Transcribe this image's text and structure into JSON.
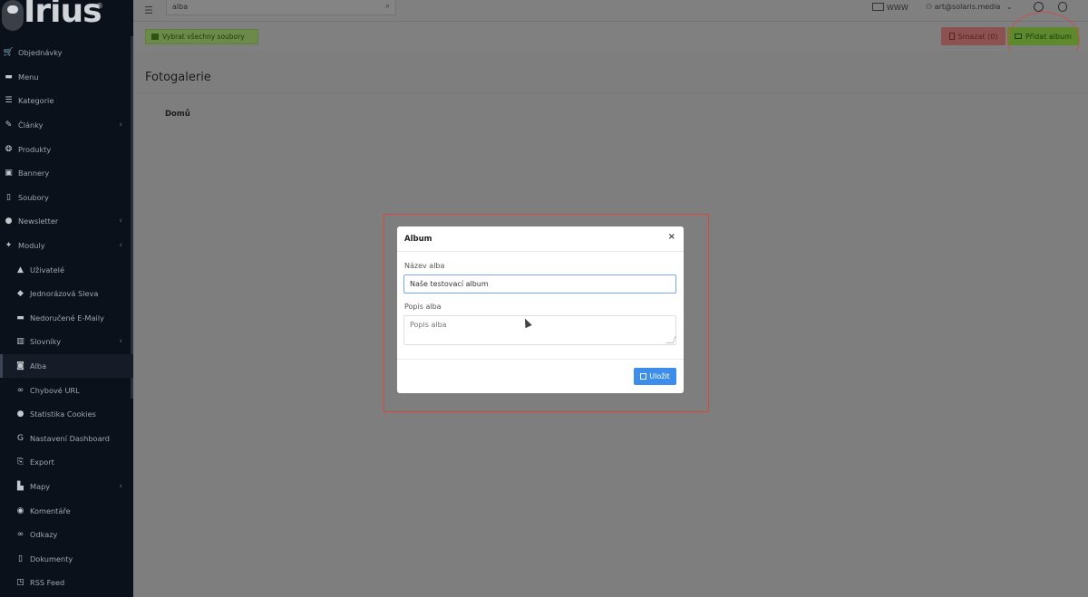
{
  "logo": {
    "word": "Irius",
    "registered": "®"
  },
  "sidebar": {
    "items": [
      {
        "label": "Objednávky",
        "icon": "cart-icon",
        "glyph": "🛒",
        "sub": false,
        "chevron": false
      },
      {
        "label": "Menu",
        "icon": "folder-icon",
        "glyph": "▬",
        "sub": false,
        "chevron": false
      },
      {
        "label": "Kategorie",
        "icon": "list-icon",
        "glyph": "☰",
        "sub": false,
        "chevron": false
      },
      {
        "label": "Články",
        "icon": "pencil-icon",
        "glyph": "✎",
        "sub": false,
        "chevron": true
      },
      {
        "label": "Produkty",
        "icon": "gear-icon",
        "glyph": "❂",
        "sub": false,
        "chevron": false
      },
      {
        "label": "Bannery",
        "icon": "image-icon",
        "glyph": "▣",
        "sub": false,
        "chevron": false
      },
      {
        "label": "Soubory",
        "icon": "file-icon",
        "glyph": "▯",
        "sub": false,
        "chevron": false
      },
      {
        "label": "Newsletter",
        "icon": "newsletter-icon",
        "glyph": "●",
        "sub": false,
        "chevron": true
      },
      {
        "label": "Moduly",
        "icon": "puzzle-icon",
        "glyph": "✦",
        "sub": false,
        "chevron": true
      },
      {
        "label": "Uživatelé",
        "icon": "user-icon",
        "glyph": "▲",
        "sub": true,
        "chevron": false
      },
      {
        "label": "Jednorázová Sleva",
        "icon": "tag-icon",
        "glyph": "◆",
        "sub": true,
        "chevron": false
      },
      {
        "label": "Nedoručené E-Maily",
        "icon": "truck-icon",
        "glyph": "▬",
        "sub": true,
        "chevron": false
      },
      {
        "label": "Slovníky",
        "icon": "book-icon",
        "glyph": "▥",
        "sub": true,
        "chevron": true
      },
      {
        "label": "Alba",
        "icon": "camera-icon",
        "glyph": "◙",
        "sub": true,
        "chevron": false,
        "active": true
      },
      {
        "label": "Chybové URL",
        "icon": "link-icon",
        "glyph": "∞",
        "sub": true,
        "chevron": false
      },
      {
        "label": "Statistika Cookies",
        "icon": "cookie-icon",
        "glyph": "●",
        "sub": true,
        "chevron": false
      },
      {
        "label": "Nastavení Dashboard",
        "icon": "google-icon",
        "glyph": "G",
        "sub": true,
        "chevron": false
      },
      {
        "label": "Export",
        "icon": "export-icon",
        "glyph": "⎘",
        "sub": true,
        "chevron": false
      },
      {
        "label": "Mapy",
        "icon": "map-icon",
        "glyph": "▙",
        "sub": true,
        "chevron": true
      },
      {
        "label": "Komentáře",
        "icon": "comments-icon",
        "glyph": "◉",
        "sub": true,
        "chevron": false
      },
      {
        "label": "Odkazy",
        "icon": "link-icon",
        "glyph": "∞",
        "sub": true,
        "chevron": false
      },
      {
        "label": "Dokumenty",
        "icon": "document-icon",
        "glyph": "▯",
        "sub": true,
        "chevron": false
      },
      {
        "label": "RSS Feed",
        "icon": "rss-icon",
        "glyph": "◳",
        "sub": true,
        "chevron": false
      }
    ]
  },
  "topbar": {
    "search_value": "alba",
    "www_label": "WWW",
    "user_email": "art@solaris.media",
    "user_chevron": "⌄"
  },
  "toolbar": {
    "select_all_label": "Vybrat všechny soubory",
    "delete_label": "Smazat (0)",
    "add_album_label": "Přidat album"
  },
  "page": {
    "title": "Fotogalerie",
    "breadcrumb": "Domů"
  },
  "modal": {
    "title": "Album",
    "close_glyph": "×",
    "name_label": "Název alba",
    "name_value": "Naše testovací album",
    "desc_label": "Popis alba",
    "desc_placeholder": "Popis alba",
    "save_label": "Uložit"
  },
  "colors": {
    "annotation": "#d6493c",
    "save_button": "#3d8eea",
    "add_button": "#5e8a2d",
    "delete_button": "#8c5252"
  }
}
